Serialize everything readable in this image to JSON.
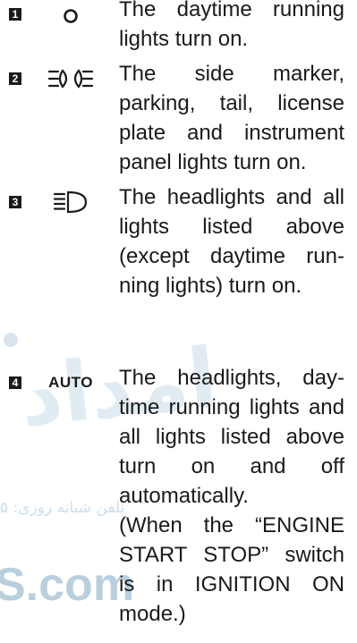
{
  "watermark": {
    "arabic_large": "امداد",
    "arabic_small": "تلفن شبانه روزی: ۵",
    "latin": "S.com"
  },
  "items": [
    {
      "number": "1",
      "icon": "circle-icon",
      "description": "The daytime running lights turn on."
    },
    {
      "number": "2",
      "icon": "side-marker-lights-icon",
      "description": "The side marker, parking, tail, license plate and instrument panel lights turn on."
    },
    {
      "number": "3",
      "icon": "headlight-icon",
      "description": "The headlights and all lights listed above (except daytime run-ning lights) turn on."
    },
    {
      "number": "4",
      "icon": "auto-icon",
      "icon_text": "AUTO",
      "description": "The headlights, day-time running lights and all lights listed above turn on and off automatically.",
      "note": "(When the “ENGINE START STOP” switch is in IGNITION ON mode.)"
    }
  ]
}
